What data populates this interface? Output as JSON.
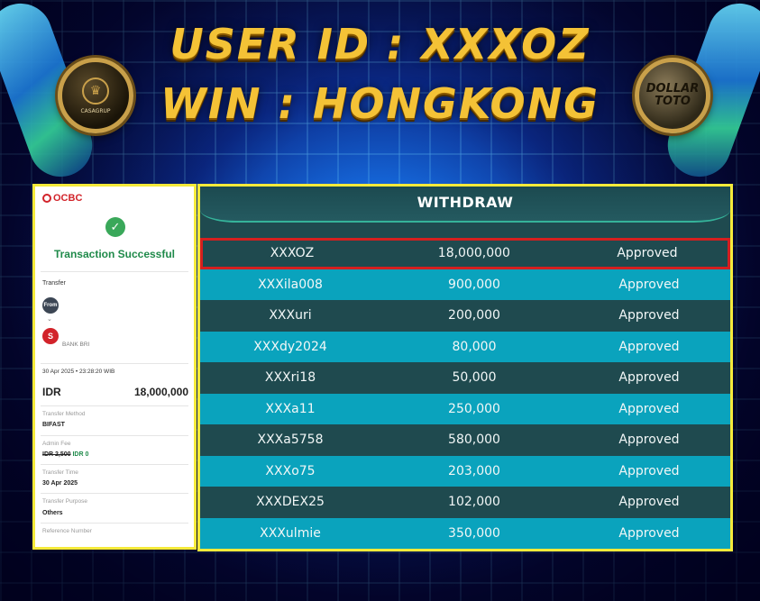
{
  "banner": {
    "line1": "USER ID : XXXOZ",
    "line2": "WIN : HONGKONG",
    "logo_left": "CASAGRUP",
    "logo_right_line1": "DOLLAR",
    "logo_right_line2": "TOTO"
  },
  "receipt": {
    "bank": "OCBC",
    "status": "Transaction Successful",
    "section": "Transfer",
    "from_badge": "From",
    "to_initial": "S",
    "to_bank": "BANK BRI",
    "datetime": "30 Apr 2025 • 23:28:20 WIB",
    "currency": "IDR",
    "amount": "18,000,000",
    "method_label": "Transfer Method",
    "method_value": "BIFAST",
    "fee_label": "Admin Fee",
    "fee_old": "IDR 2,500",
    "fee_new": "IDR 0",
    "time_label": "Transfer Time",
    "time_value": "30 Apr 2025",
    "purpose_label": "Transfer Purpose",
    "purpose_value": "Others",
    "ref_label": "Reference Number"
  },
  "withdraw": {
    "title": "WITHDRAW",
    "rows": [
      {
        "user": "XXXOZ",
        "amount": "18,000,000",
        "status": "Approved"
      },
      {
        "user": "XXXila008",
        "amount": "900,000",
        "status": "Approved"
      },
      {
        "user": "XXXuri",
        "amount": "200,000",
        "status": "Approved"
      },
      {
        "user": "XXXdy2024",
        "amount": "80,000",
        "status": "Approved"
      },
      {
        "user": "XXXri18",
        "amount": "50,000",
        "status": "Approved"
      },
      {
        "user": "XXXa11",
        "amount": "250,000",
        "status": "Approved"
      },
      {
        "user": "XXXa5758",
        "amount": "580,000",
        "status": "Approved"
      },
      {
        "user": "XXXo75",
        "amount": "203,000",
        "status": "Approved"
      },
      {
        "user": "XXXDEX25",
        "amount": "102,000",
        "status": "Approved"
      },
      {
        "user": "XXXulmie",
        "amount": "350,000",
        "status": "Approved"
      }
    ]
  }
}
